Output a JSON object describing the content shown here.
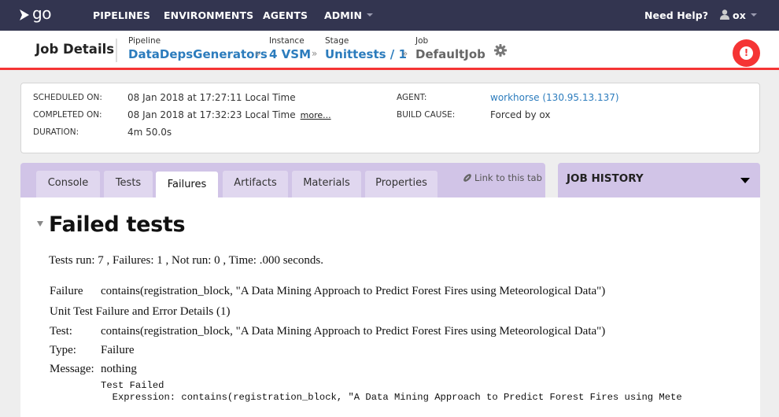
{
  "topnav": {
    "logo_text": "go",
    "items": [
      {
        "label": "PIPELINES"
      },
      {
        "label": "ENVIRONMENTS"
      },
      {
        "label": "AGENTS"
      },
      {
        "label": "ADMIN",
        "has_dropdown": true
      }
    ],
    "help_label": "Need Help?",
    "user_label": "ox"
  },
  "header": {
    "title": "Job Details",
    "breadcrumbs": [
      {
        "label": "Pipeline",
        "value": "DataDepsGenerators"
      },
      {
        "label": "Instance",
        "value": "4 VSM"
      },
      {
        "label": "Stage",
        "value": "Unittests / 1"
      },
      {
        "label": "Job",
        "value": "DefaultJob"
      }
    ],
    "separator": "»",
    "alert_symbol": "!"
  },
  "summary": {
    "scheduled_label": "SCHEDULED ON:",
    "scheduled_value": "08 Jan 2018 at 17:27:11 Local Time",
    "completed_label": "COMPLETED ON:",
    "completed_value": "08 Jan 2018 at 17:32:23 Local Time",
    "more_link": "more...",
    "duration_label": "DURATION:",
    "duration_value": "4m 50.0s",
    "agent_label": "AGENT:",
    "agent_value": "workhorse (130.95.13.137)",
    "build_cause_label": "BUILD CAUSE:",
    "build_cause_value": "Forced by ox"
  },
  "tabs": {
    "items": [
      {
        "label": "Console"
      },
      {
        "label": "Tests"
      },
      {
        "label": "Failures",
        "active": true
      },
      {
        "label": "Artifacts"
      },
      {
        "label": "Materials"
      },
      {
        "label": "Properties"
      }
    ],
    "link_label": "Link to this tab"
  },
  "job_history": {
    "title": "JOB HISTORY"
  },
  "failures": {
    "title": "Failed tests",
    "summary": "Tests run: 7 , Failures: 1 , Not run: 0 , Time: .000 seconds.",
    "failure_label": "Failure",
    "failure_value": "contains(registration_block, \"A Data Mining Approach to Predict Forest Fires using Meteorological Data\")",
    "details_heading": "Unit Test Failure and Error Details (1)",
    "test_label": "Test:",
    "test_value": "contains(registration_block, \"A Data Mining Approach to Predict Forest Fires using Meteorological Data\")",
    "type_label": "Type:",
    "type_value": "Failure",
    "message_label": "Message:",
    "message_value": "nothing",
    "trace_line1": "Test Failed",
    "trace_line2": "  Expression: contains(registration_block, \"A Data Mining Approach to Predict Forest Fires using Mete"
  },
  "colors": {
    "nav_bg": "#333550",
    "accent_red": "#f53434",
    "link_blue": "#2c7cbd",
    "tab_bar": "#d1c4e7",
    "tab_inactive": "#e0d7ef"
  }
}
